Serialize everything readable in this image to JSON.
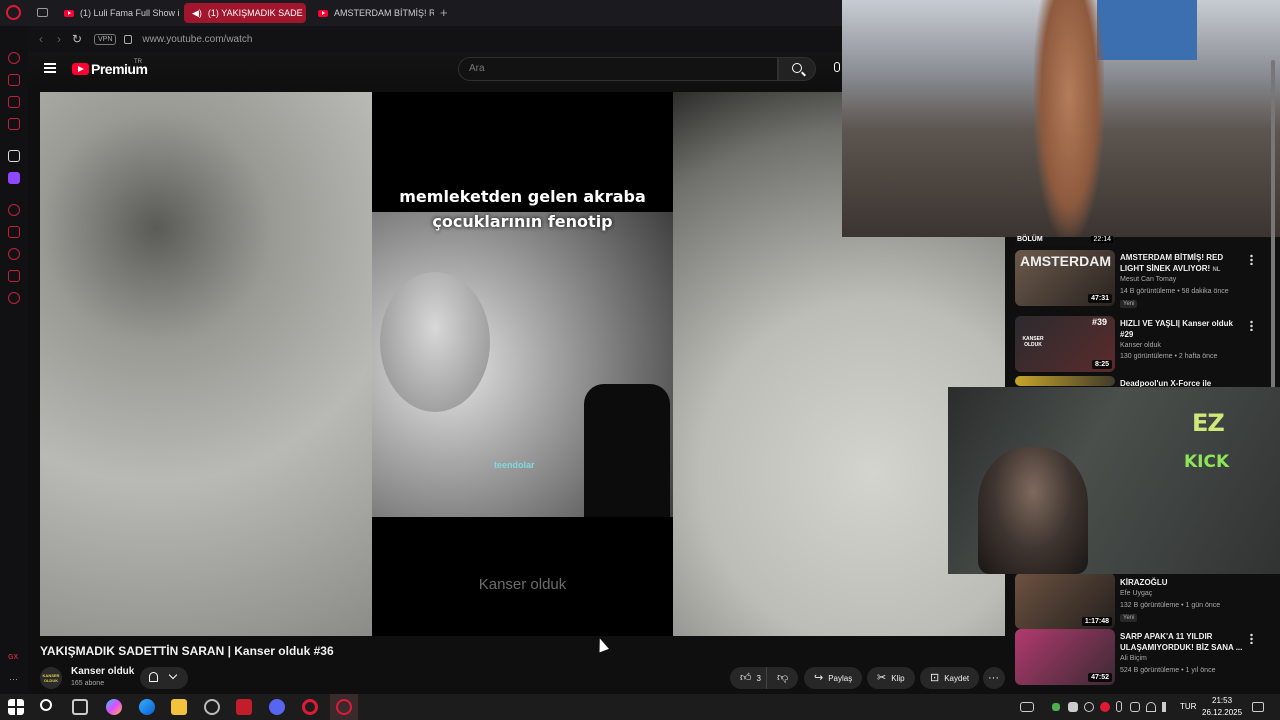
{
  "browser": {
    "tabs": [
      {
        "label": "(1) Luli Fama Full Show in"
      },
      {
        "label": "(1) YAKIŞMADIK SADE"
      },
      {
        "label": "AMSTERDAM BİTMİŞ! RE"
      }
    ],
    "vpn": "VPN",
    "url": "www.youtube.com/watch"
  },
  "youtube": {
    "brand": "Premium",
    "region": "TR",
    "search_placeholder": "Ara"
  },
  "video": {
    "caption": "memleketden gelen akraba çocuklarının fenotip",
    "watermark": "teendolar",
    "footer": "Kanser olduk",
    "title": "YAKIŞMADIK SADETTİN SARAN | Kanser olduk #36",
    "channel": "Kanser olduk",
    "subscribers": "165 abone",
    "avatar_text": "KANSER OLDUK",
    "likes": "3",
    "share": "Paylaş",
    "clip": "Klip",
    "save": "Kaydet"
  },
  "overlay": {
    "ez": "EZ",
    "kick": "KICK"
  },
  "suggestions": [
    {
      "title": "AMSTERDAM BİTMİŞ! RED LIGHT SİNEK AVLIYOR!",
      "title_tag": "NL",
      "channel": "Mesut Can Tomay",
      "views": "14 B görüntüleme",
      "age": "58 dakika önce",
      "badge": "Yeni",
      "duration": "47:31"
    },
    {
      "title": "HIZLI VE YAŞLI| Kanser olduk #29",
      "channel": "Kanser olduk",
      "views": "130 görüntüleme",
      "age": "2 hafta önce",
      "duration": "8:25"
    },
    {
      "title": "Deadpool'un X-Force ile"
    },
    {
      "title": "KİRAZOĞLU",
      "channel": "Efe Uygaç",
      "views": "132 B görüntüleme",
      "age": "1 gün önce",
      "badge": "Yeni",
      "duration": "1:17:48"
    },
    {
      "title": "SARP APAK'A 11 YILDIR ULAŞAMIYORDUK! BİZ SANA ...",
      "channel": "Ali Biçim",
      "views": "524 B görüntüleme",
      "age": "1 yıl önce",
      "duration": "47:52"
    }
  ],
  "partial_duration": "22:14",
  "partial_label": "BÖLÜM",
  "thumb_labels": {
    "t1": "AMSTERDAM",
    "t2": "#39",
    "t3": "KANSER OLDUK"
  },
  "taskbar": {
    "lang": "TUR",
    "time": "21:53",
    "date": "26.12.2025"
  }
}
